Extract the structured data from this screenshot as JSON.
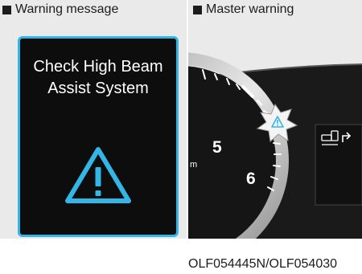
{
  "captions": {
    "warning_message": "Warning message",
    "master_warning": "Master warning"
  },
  "display": {
    "message_line1": "Check High Beam",
    "message_line2": "Assist System",
    "icon": "warning-triangle-icon",
    "accent_color": "#33b5e5",
    "background_color": "#0d0d0d"
  },
  "gauge": {
    "tick_labels": [
      "5",
      "6"
    ],
    "unit_fragment": "m",
    "master_warning_icon": "master-warning-icon",
    "side_icons": [
      "lane-change-assist-icon",
      "turn-arrow-icon"
    ]
  },
  "reference_code": "OLF054445N/OLF054030"
}
